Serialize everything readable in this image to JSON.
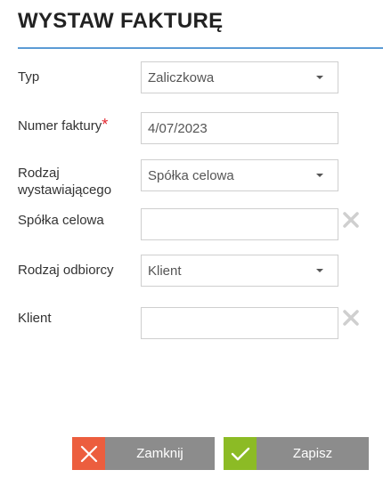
{
  "header": {
    "title": "WYSTAW FAKTURĘ"
  },
  "form": {
    "typ": {
      "label": "Typ",
      "value": "Zaliczkowa"
    },
    "numer": {
      "label": "Numer faktury",
      "required_mark": "*",
      "value": "4/07/2023"
    },
    "rodzaj_wystawiajacego": {
      "label_line1": "Rodzaj",
      "label_line2": "wystawiającego",
      "value": "Spółka celowa"
    },
    "spolka_celowa": {
      "label": "Spółka celowa",
      "value": ""
    },
    "rodzaj_odbiorcy": {
      "label": "Rodzaj odbiorcy",
      "value": "Klient"
    },
    "klient": {
      "label": "Klient",
      "value": ""
    }
  },
  "buttons": {
    "close_label": "Zamknij",
    "save_label": "Zapisz"
  },
  "colors": {
    "accent_rule": "#5b9bd5",
    "required": "#e3262f",
    "close_icon_bg": "#ec5e3e",
    "save_icon_bg": "#8cbb25",
    "button_body": "#8c8c8c"
  },
  "icons": {
    "dropdown": "caret-down-icon",
    "clear": "clear-x-icon",
    "close": "close-icon",
    "save": "checkmark-icon"
  }
}
